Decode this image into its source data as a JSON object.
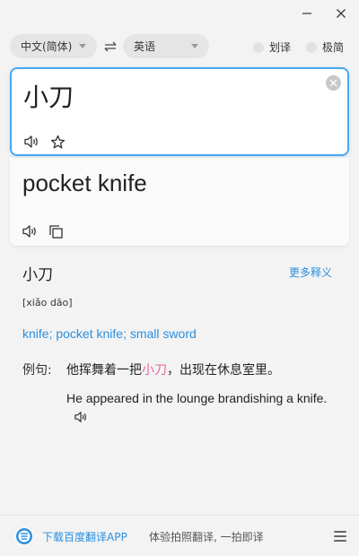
{
  "window": {
    "minimize_icon": "minimize-icon",
    "close_icon": "close-icon"
  },
  "lang_bar": {
    "source_lang": "中文(简体)",
    "target_lang": "英语",
    "swap_icon": "swap-arrows-icon",
    "toggles": [
      {
        "label": "划译",
        "on": false
      },
      {
        "label": "极简",
        "on": false
      }
    ]
  },
  "input": {
    "text": "小刀",
    "icons": [
      "speaker-icon",
      "star-icon",
      "clear-icon"
    ]
  },
  "output": {
    "text": "pocket knife",
    "icons": [
      "speaker-icon",
      "copy-icon"
    ]
  },
  "dictionary": {
    "word": "小刀",
    "more_link": "更多释义",
    "pinyin": "[xiǎo dāo]",
    "meanings": [
      "knife",
      "pocket knife",
      "small sword"
    ],
    "example": {
      "label": "例句:",
      "cn_before": "他挥舞着一把",
      "cn_highlight": "小刀",
      "cn_after": "，出现在休息室里。",
      "en": "He appeared in the lounge brandishing a knife."
    }
  },
  "footer": {
    "link": "下载百度翻译APP",
    "slogan": "体验拍照翻译, 一拍即译",
    "logo_icon": "baidu-translate-logo-icon",
    "menu_icon": "menu-icon"
  },
  "colors": {
    "accent": "#2b8fe0",
    "input_border": "#4aa8f0",
    "highlight": "#e8649a",
    "background": "#f3f3f3"
  }
}
